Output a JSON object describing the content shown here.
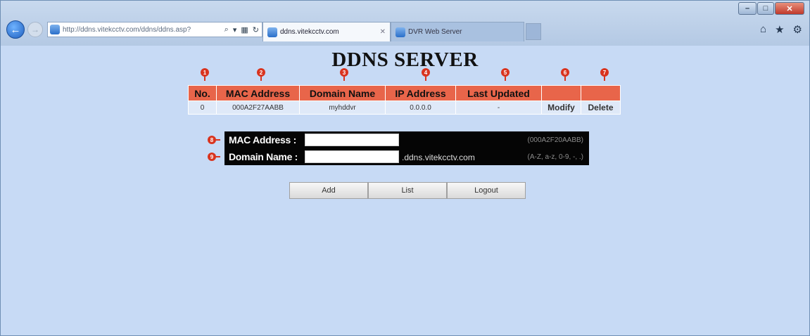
{
  "browser": {
    "address_url": "http://ddns.vitekcctv.com/ddns/ddns.asp?",
    "tabs": [
      {
        "label": "ddns.vitekcctv.com",
        "active": true
      },
      {
        "label": "DVR Web Server",
        "active": false
      }
    ]
  },
  "page": {
    "title": "DDNS SERVER"
  },
  "table": {
    "headers": [
      "No.",
      "MAC Address",
      "Domain Name",
      "IP Address",
      "Last Updated",
      "",
      ""
    ],
    "rows": [
      {
        "no": "0",
        "mac": "000A2F27AABB",
        "domain": "myhddvr",
        "ip": "0.0.0.0",
        "updated": "-",
        "modify": "Modify",
        "delete": "Delete"
      }
    ]
  },
  "markers": [
    "1",
    "2",
    "3",
    "4",
    "5",
    "6",
    "7",
    "8",
    "9"
  ],
  "form": {
    "mac_label": "MAC Address :",
    "mac_value": "",
    "mac_hint": "(000A2F20AABB)",
    "domain_label": "Domain Name :",
    "domain_value": "",
    "domain_suffix": ".ddns.vitekcctv.com",
    "domain_hint": "(A-Z, a-z, 0-9, -, .)"
  },
  "buttons": {
    "add": "Add",
    "list": "List",
    "logout": "Logout"
  },
  "colors": {
    "header_bg": "#e8654a",
    "marker": "#d9341f",
    "link": "#2f5fbf",
    "page_bg": "#c7daf5"
  }
}
